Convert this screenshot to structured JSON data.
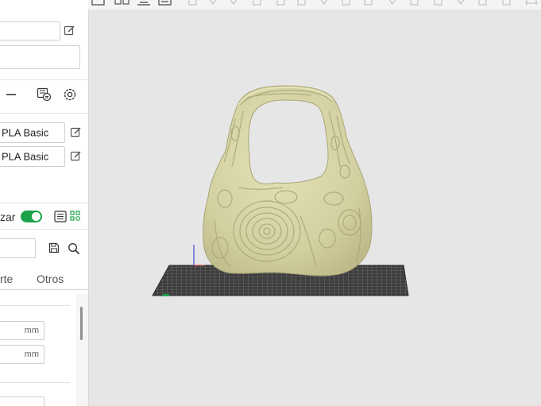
{
  "panel": {
    "filament_1_name": "PLA Basic",
    "filament_2_name": "PLA Basic",
    "toggle_label": "zar",
    "tabs": {
      "partial": "rte",
      "others": "Otros"
    },
    "unit_1": "mm",
    "unit_2": "mm"
  },
  "icons": {
    "edit": "edit-icon",
    "minus": "minus-icon",
    "filament_sync": "filament-sync-icon",
    "settings": "gear-icon",
    "list": "list-icon",
    "save": "save-icon",
    "search": "search-icon"
  },
  "colors": {
    "accent_green": "#1aa34a",
    "model": "#d9d7ab",
    "viewport_bg": "#e6e6e6"
  }
}
